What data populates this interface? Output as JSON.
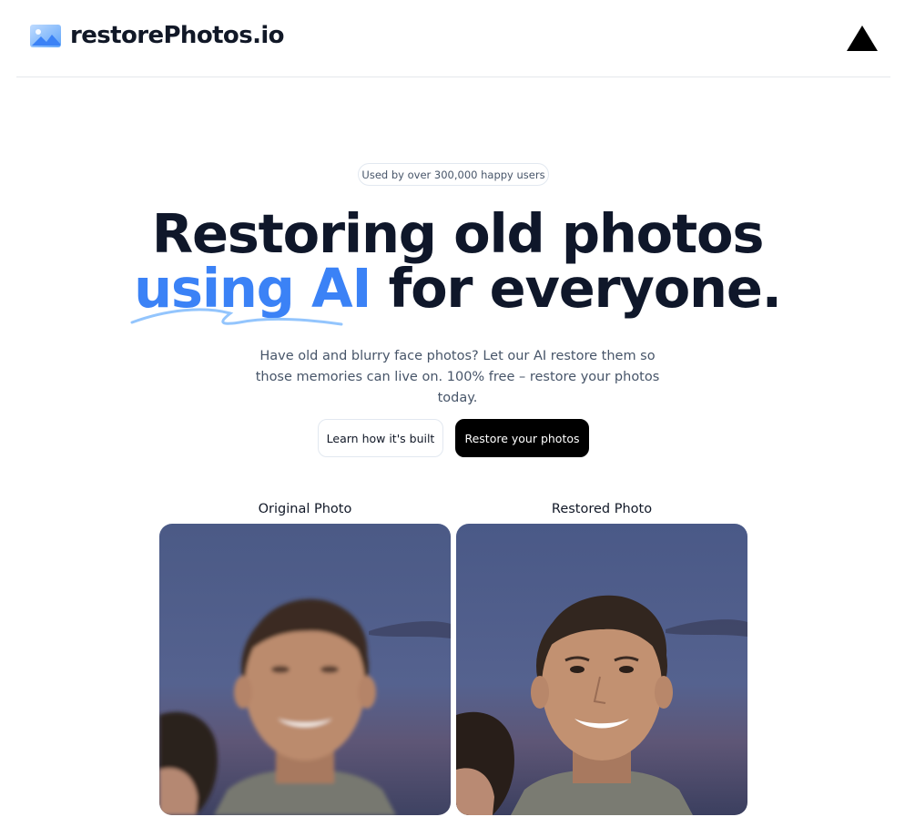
{
  "header": {
    "brand": "restorePhotos.io",
    "logo_icon": "image-photo-icon",
    "right_icon": "vercel-triangle-icon"
  },
  "hero": {
    "badge": "Used by over 300,000 happy users",
    "title_line1": "Restoring old photos",
    "title_highlight": "using AI",
    "title_rest": " for everyone.",
    "subtitle": "Have old and blurry face photos? Let our AI restore them so those memories can live on. 100% free – restore your photos today."
  },
  "actions": {
    "learn_label": "Learn how it's built",
    "restore_label": "Restore your photos"
  },
  "comparison": {
    "original_label": "Original Photo",
    "restored_label": "Restored Photo"
  },
  "colors": {
    "accent": "#3b82f6",
    "primary_button": "#000000",
    "heading": "#0f172a",
    "body_text": "#475569"
  }
}
